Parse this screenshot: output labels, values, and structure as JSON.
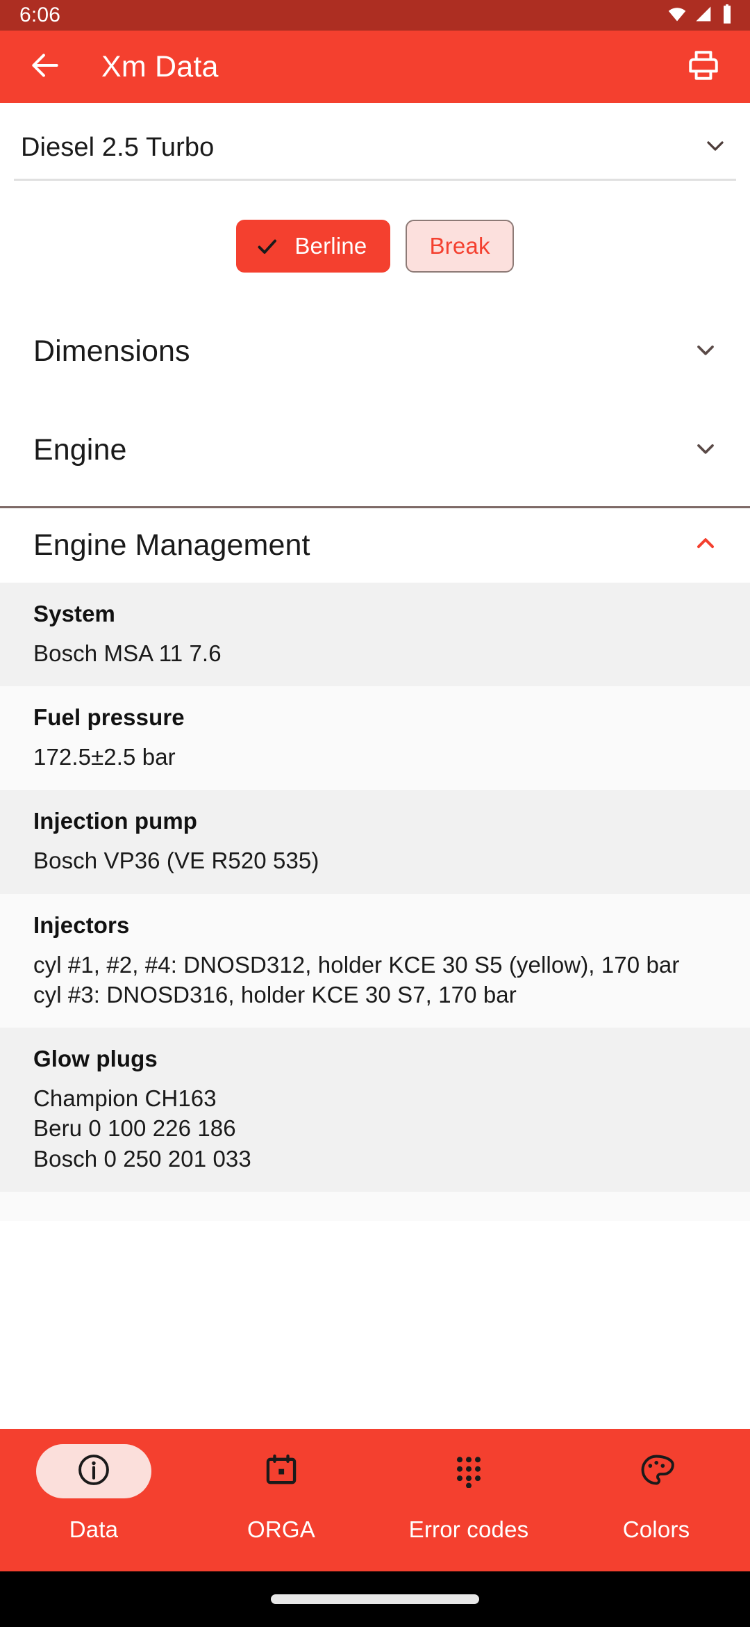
{
  "status_bar": {
    "time": "6:06",
    "icons": [
      "wifi-icon",
      "cellular-signal-icon",
      "battery-icon"
    ],
    "background": "#AD2E22"
  },
  "app_bar": {
    "back_icon": "back-arrow-icon",
    "title": "Xm Data",
    "print_icon": "print-icon",
    "background": "#F4402F"
  },
  "engine_select": {
    "value": "Diesel 2.5 Turbo",
    "chevron_icon": "chevron-down-icon"
  },
  "body_toggle": {
    "options": [
      {
        "label": "Berline",
        "selected": true,
        "check_icon": "check-icon"
      },
      {
        "label": "Break",
        "selected": false,
        "check_icon": ""
      }
    ],
    "selected_bg": "#F4402F",
    "unselected_bg": "#FCE0DD",
    "unselected_text": "#F4402F",
    "unselected_border": "#8D7A76"
  },
  "sections": [
    {
      "title": "Dimensions",
      "expanded": false,
      "chevron_icon": "chevron-down-icon",
      "chevron_color": "#5A4A47"
    },
    {
      "title": "Engine",
      "expanded": false,
      "chevron_icon": "chevron-down-icon",
      "chevron_color": "#5A4A47"
    },
    {
      "title": "Engine Management",
      "expanded": true,
      "chevron_icon": "chevron-up-icon",
      "chevron_color": "#F4402F"
    }
  ],
  "engine_management_rows": [
    {
      "label": "System",
      "lines": [
        "Bosch MSA 11 7.6"
      ]
    },
    {
      "label": "Fuel pressure",
      "lines": [
        "172.5±2.5 bar"
      ]
    },
    {
      "label": "Injection pump",
      "lines": [
        "Bosch VP36 (VE R520 535)"
      ]
    },
    {
      "label": "Injectors",
      "lines": [
        "cyl #1, #2, #4: DNOSD312, holder KCE 30 S5 (yellow), 170 bar",
        "cyl #3: DNOSD316, holder KCE 30 S7, 170 bar"
      ]
    },
    {
      "label": "Glow plugs",
      "lines": [
        "Champion CH163",
        "Beru 0 100 226 186",
        "Bosch 0 250 201 033"
      ]
    }
  ],
  "bottom_nav": {
    "items": [
      {
        "label": "Data",
        "icon": "info-icon",
        "active": true
      },
      {
        "label": "ORGA",
        "icon": "calendar-icon",
        "active": false
      },
      {
        "label": "Error codes",
        "icon": "dialpad-icon",
        "active": false
      },
      {
        "label": "Colors",
        "icon": "palette-icon",
        "active": false
      }
    ],
    "background": "#F4402F",
    "active_pill": "#FBDFDB"
  }
}
